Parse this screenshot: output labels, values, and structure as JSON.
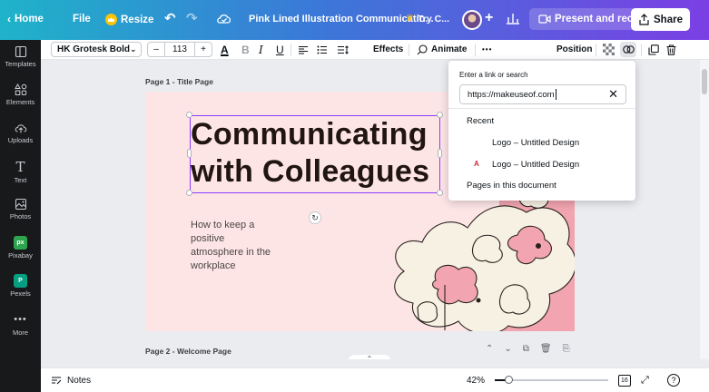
{
  "topbar": {
    "home": "Home",
    "file": "File",
    "resize": "Resize",
    "doc_title": "Pink Lined Illustration Communicatio...",
    "try_label": "Try C...",
    "present_label": "Present and record",
    "share_label": "Share"
  },
  "sidebar": {
    "items": [
      {
        "label": "Templates",
        "icon": "templates-icon"
      },
      {
        "label": "Elements",
        "icon": "elements-icon"
      },
      {
        "label": "Uploads",
        "icon": "uploads-icon"
      },
      {
        "label": "Text",
        "icon": "text-icon"
      },
      {
        "label": "Photos",
        "icon": "photos-icon"
      },
      {
        "label": "Pixabay",
        "icon": "pixabay-icon"
      },
      {
        "label": "Pexels",
        "icon": "pexels-icon"
      },
      {
        "label": "More",
        "icon": "more-icon"
      }
    ]
  },
  "toolbar": {
    "font": "HK Grotesk Bold",
    "font_size": "113",
    "minus": "–",
    "plus": "+",
    "effects": "Effects",
    "animate": "Animate",
    "more": "•••",
    "position": "Position"
  },
  "canvas": {
    "page1_label": "Page 1 - Title Page",
    "headline_line1": "Communicating",
    "headline_line2": "with Colleagues",
    "subtext": "How to keep a positive atmosphere in the workplace",
    "page2_label": "Page 2 - Welcome Page"
  },
  "link_popup": {
    "header": "Enter a link or search",
    "input_value": "https://makeuseof.com",
    "recent_label": "Recent",
    "recent_items": [
      "Logo – Untitled Design",
      "Logo – Untitled Design"
    ],
    "pages_label": "Pages in this document"
  },
  "bottombar": {
    "notes": "Notes",
    "zoom": "42%",
    "zoom_fraction": 0.42,
    "page_count": "16"
  },
  "colors": {
    "accent_purple": "#8b3dff",
    "slide_bg": "#fde5e6",
    "blob_pink": "#f2a5b0",
    "blob_cream": "#f7f1e3"
  }
}
